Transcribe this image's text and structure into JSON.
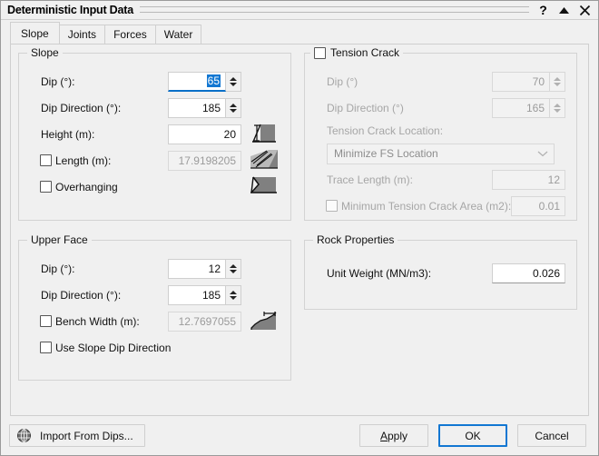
{
  "window": {
    "title": "Deterministic Input Data",
    "buttons": [
      {
        "name": "help-icon",
        "glyph": "?"
      },
      {
        "name": "collapse-icon",
        "glyph": "▲"
      },
      {
        "name": "close-icon",
        "glyph": "✕"
      }
    ]
  },
  "tabs": [
    {
      "label": "Slope",
      "active": true
    },
    {
      "label": "Joints",
      "active": false
    },
    {
      "label": "Forces",
      "active": false
    },
    {
      "label": "Water",
      "active": false
    }
  ],
  "slope_group": {
    "legend": "Slope",
    "dip_label": "Dip (°):",
    "dip_value": "65",
    "dip_direction_label": "Dip Direction (°):",
    "dip_direction_value": "185",
    "height_label": "Height (m):",
    "height_value": "20",
    "length_label": "Length (m):",
    "length_value": "17.9198205",
    "length_checked": false,
    "overhanging_label": "Overhanging",
    "overhanging_checked": false
  },
  "upper_face_group": {
    "legend": "Upper Face",
    "dip_label": "Dip (°):",
    "dip_value": "12",
    "dip_direction_label": "Dip Direction (°):",
    "dip_direction_value": "185",
    "bench_width_label": "Bench Width (m):",
    "bench_width_value": "12.7697055",
    "bench_width_checked": false,
    "use_slope_dip_direction_label": "Use Slope Dip Direction",
    "use_slope_dip_direction_checked": false
  },
  "tension_crack_group": {
    "legend": "Tension Crack",
    "enabled": false,
    "dip_label": "Dip (°)",
    "dip_value": "70",
    "dip_direction_label": "Dip Direction (°)",
    "dip_direction_value": "165",
    "location_label": "Tension Crack Location:",
    "location_value": "Minimize FS Location",
    "trace_length_label": "Trace Length (m):",
    "trace_length_value": "12",
    "min_area_label": "Minimum Tension Crack Area (m2):",
    "min_area_value": "0.01",
    "min_area_checked": false
  },
  "rock_properties_group": {
    "legend": "Rock Properties",
    "unit_weight_label": "Unit Weight (MN/m3):",
    "unit_weight_value": "0.026"
  },
  "footer": {
    "import_label": "Import From Dips...",
    "import_icon": "globe-icon",
    "apply_label": "Apply",
    "apply_mnemonic": "A",
    "ok_label": "OK",
    "cancel_label": "Cancel"
  },
  "colors": {
    "accent": "#1277d2",
    "selection": "#1277d2",
    "window_bg": "#f0f0f0",
    "border": "#cfcfcf",
    "disabled_text": "#9b9b9b",
    "diagram_fill": "#808080"
  }
}
